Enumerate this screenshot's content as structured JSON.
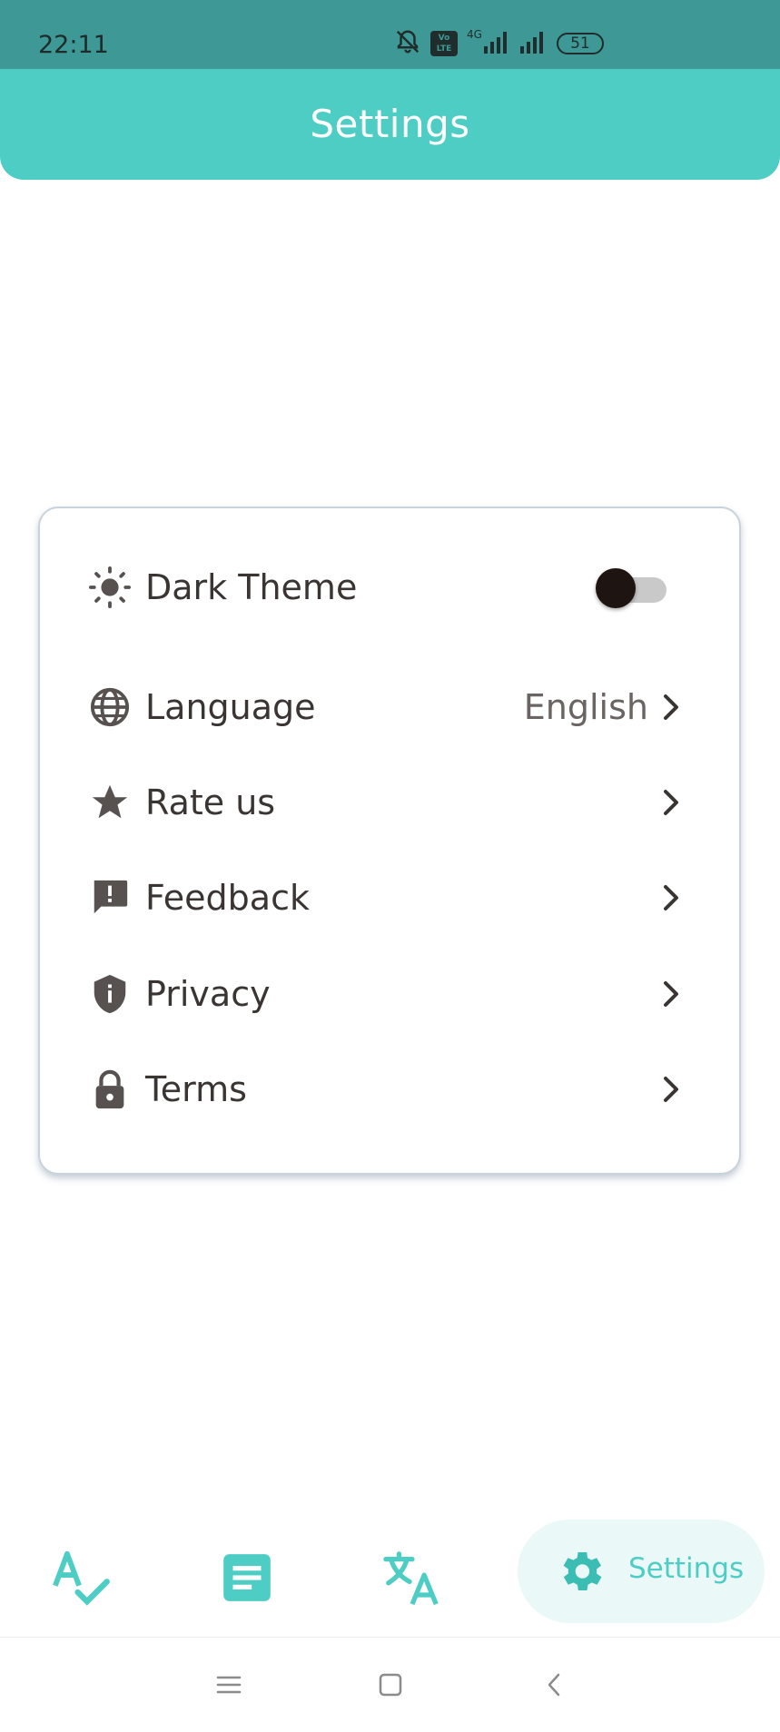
{
  "status_bar": {
    "time": "22:11",
    "volte": "Vo LTE",
    "network": "4G",
    "battery": "51"
  },
  "app_bar": {
    "title": "Settings"
  },
  "settings": {
    "items": [
      {
        "icon": "sun-icon",
        "label": "Dark Theme",
        "control": "toggle",
        "toggle_on": false
      },
      {
        "icon": "globe-icon",
        "label": "Language",
        "value": "English"
      },
      {
        "icon": "star-icon",
        "label": "Rate us"
      },
      {
        "icon": "feedback-icon",
        "label": "Feedback"
      },
      {
        "icon": "shield-icon",
        "label": "Privacy"
      },
      {
        "icon": "lock-icon",
        "label": "Terms"
      }
    ]
  },
  "bottom_nav": {
    "items": [
      {
        "icon": "spellcheck-icon"
      },
      {
        "icon": "document-icon"
      },
      {
        "icon": "translate-icon"
      },
      {
        "icon": "gear-icon",
        "label": "Settings",
        "active": true
      }
    ]
  },
  "colors": {
    "accent": "#4ecdc4",
    "status_bar": "#3e9895",
    "active_pill": "#eaf8f7",
    "text": "#3a3432"
  }
}
